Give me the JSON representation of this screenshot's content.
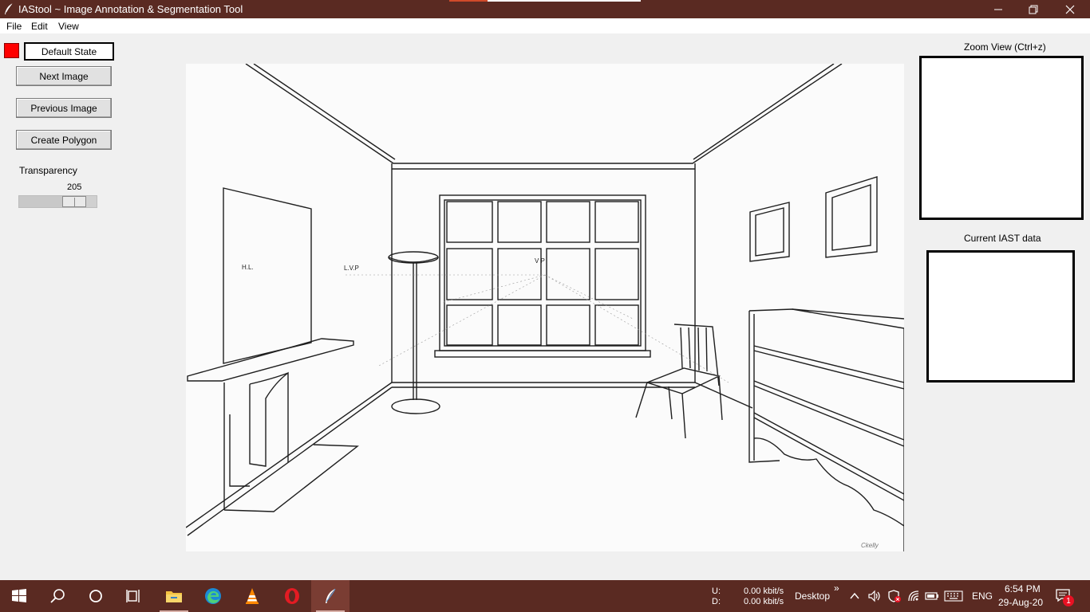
{
  "window": {
    "title": "IAStool  ~ Image Annotation & Segmentation Tool",
    "controls": [
      "minimize",
      "restore",
      "close"
    ]
  },
  "menu": {
    "file": "File",
    "edit": "Edit",
    "view": "View"
  },
  "left_panel": {
    "color_swatch": "#ff0000",
    "state_label": "Default State",
    "next_button": "Next Image",
    "previous_button": "Previous Image",
    "polygon_button": "Create Polygon",
    "transparency_label": "Transparency",
    "transparency_value": "205",
    "transparency_max": 255
  },
  "canvas": {
    "image_labels": {
      "hl": "H.L.",
      "lvp": "L.V.P",
      "vp": "V  P",
      "signature": "Ckelly"
    }
  },
  "right_panel": {
    "zoom_title": "Zoom View (Ctrl+z)",
    "data_title": "Current IAST data"
  },
  "taskbar": {
    "apps": [
      "windows-start-icon",
      "search-icon",
      "cortana-icon",
      "task-view-icon",
      "file-explorer-icon",
      "edge-icon",
      "vlc-icon",
      "opera-icon",
      "iastool-feather-icon"
    ],
    "net_up_label": "U:",
    "net_down_label": "D:",
    "net_up": "0.00 kbit/s",
    "net_down": "0.00 kbit/s",
    "desktop": "Desktop",
    "chevron": "»",
    "language": "ENG",
    "time": "6:54 PM",
    "date": "29-Aug-20",
    "notification_count": "1"
  },
  "colors": {
    "titlebar": "#5a2a22",
    "taskbar": "#5a2a22",
    "background": "#f0f0f0"
  }
}
